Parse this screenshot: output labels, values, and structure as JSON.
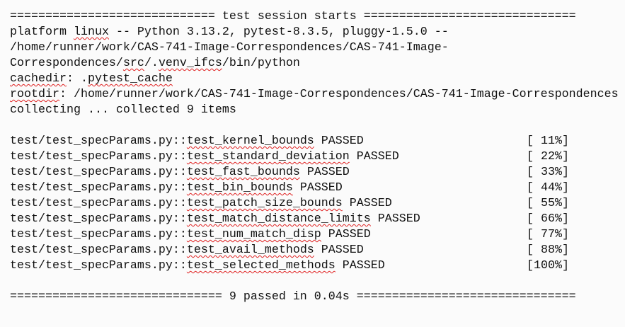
{
  "header": [
    [
      {
        "t": "============================= test session starts =============================="
      }
    ],
    [
      {
        "t": "platform "
      },
      {
        "t": "linux",
        "err": true
      },
      {
        "t": " -- Python 3.13.2, pytest-8.3.5, pluggy-1.5.0 --"
      }
    ],
    [
      {
        "t": "/home/runner/work/CAS-741-Image-Correspondences/CAS-741-Image-"
      }
    ],
    [
      {
        "t": "Correspondences/"
      },
      {
        "t": "src",
        "err": true
      },
      {
        "t": "/."
      },
      {
        "t": "venv_ifcs",
        "err": true
      },
      {
        "t": "/bin/python"
      }
    ],
    [
      {
        "t": "cachedir",
        "err": true
      },
      {
        "t": ": ."
      },
      {
        "t": "pytest_cache",
        "err": true
      }
    ],
    [
      {
        "t": "rootdir",
        "err": true
      },
      {
        "t": ": /home/runner/work/CAS-741-Image-Correspondences/CAS-741-Image-Correspondences"
      }
    ],
    [
      {
        "t": "collecting ... collected 9 items"
      }
    ]
  ],
  "tests": [
    {
      "prefix": "test/test_specParams.py::",
      "name": "test_kernel_bounds",
      "status": " PASSED",
      "pct": "[ 11%]"
    },
    {
      "prefix": "test/test_specParams.py::",
      "name": "test_standard_deviation",
      "status": " PASSED",
      "pct": "[ 22%]"
    },
    {
      "prefix": "test/test_specParams.py::",
      "name": "test_fast_bounds",
      "status": " PASSED",
      "pct": "[ 33%]"
    },
    {
      "prefix": "test/test_specParams.py::",
      "name": "test_bin_bounds",
      "status": " PASSED",
      "pct": "[ 44%]"
    },
    {
      "prefix": "test/test_specParams.py::",
      "name": "test_patch_size_bounds",
      "status": " PASSED",
      "pct": "[ 55%]"
    },
    {
      "prefix": "test/test_specParams.py::",
      "name": "test_match_distance_limits",
      "status": " PASSED",
      "pct": "[ 66%]"
    },
    {
      "prefix": "test/test_specParams.py::",
      "name": "test_num_match_disp",
      "status": " PASSED",
      "pct": "[ 77%]"
    },
    {
      "prefix": "test/test_specParams.py::",
      "name": "test_avail_methods",
      "status": " PASSED",
      "pct": "[ 88%]"
    },
    {
      "prefix": "test/test_specParams.py::",
      "name": "test_selected_methods",
      "status": " PASSED",
      "pct": "[100%]"
    }
  ],
  "footer": "============================== 9 passed in 0.04s ==============================="
}
